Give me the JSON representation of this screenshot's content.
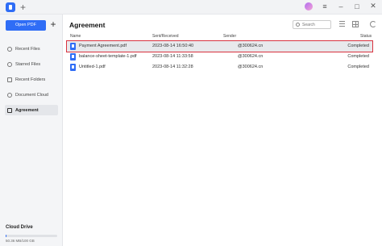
{
  "sidebar": {
    "open_pdf_label": "Open PDF",
    "add_label": "+",
    "items": [
      {
        "label": "Recent Files",
        "icon": "clock-icon"
      },
      {
        "label": "Starred Files",
        "icon": "star-icon"
      },
      {
        "label": "Recent Folders",
        "icon": "folder-icon"
      },
      {
        "label": "Document Cloud",
        "icon": "cloud-icon"
      },
      {
        "label": "Agreement",
        "icon": "agreement-icon"
      }
    ],
    "cloud_drive": {
      "title": "Cloud Drive",
      "usage": "50.36 MB/100 GB",
      "used_fraction": 0.0005
    }
  },
  "titlebar": {
    "new_tab_label": "+"
  },
  "main": {
    "title": "Agreement",
    "search": {
      "placeholder": "Search"
    },
    "columns": {
      "name": "Name",
      "sent": "Sent/Received",
      "sender": "Sender",
      "status": "Status"
    },
    "rows": [
      {
        "name": "Payment Agreement.pdf",
        "sent": "2023-08-14 16:50:40",
        "sender": "@300624.cn",
        "status": "Completed"
      },
      {
        "name": "balance-sheet-template-1.pdf",
        "sent": "2023-08-14 11:33:58",
        "sender": "@300624.cn",
        "status": "Completed"
      },
      {
        "name": "Untitled-1.pdf",
        "sent": "2023-08-14 11:32:28",
        "sender": "@300624.cn",
        "status": "Completed"
      }
    ]
  },
  "colors": {
    "accent": "#2f6df6",
    "selection_outline": "#d9333f"
  }
}
